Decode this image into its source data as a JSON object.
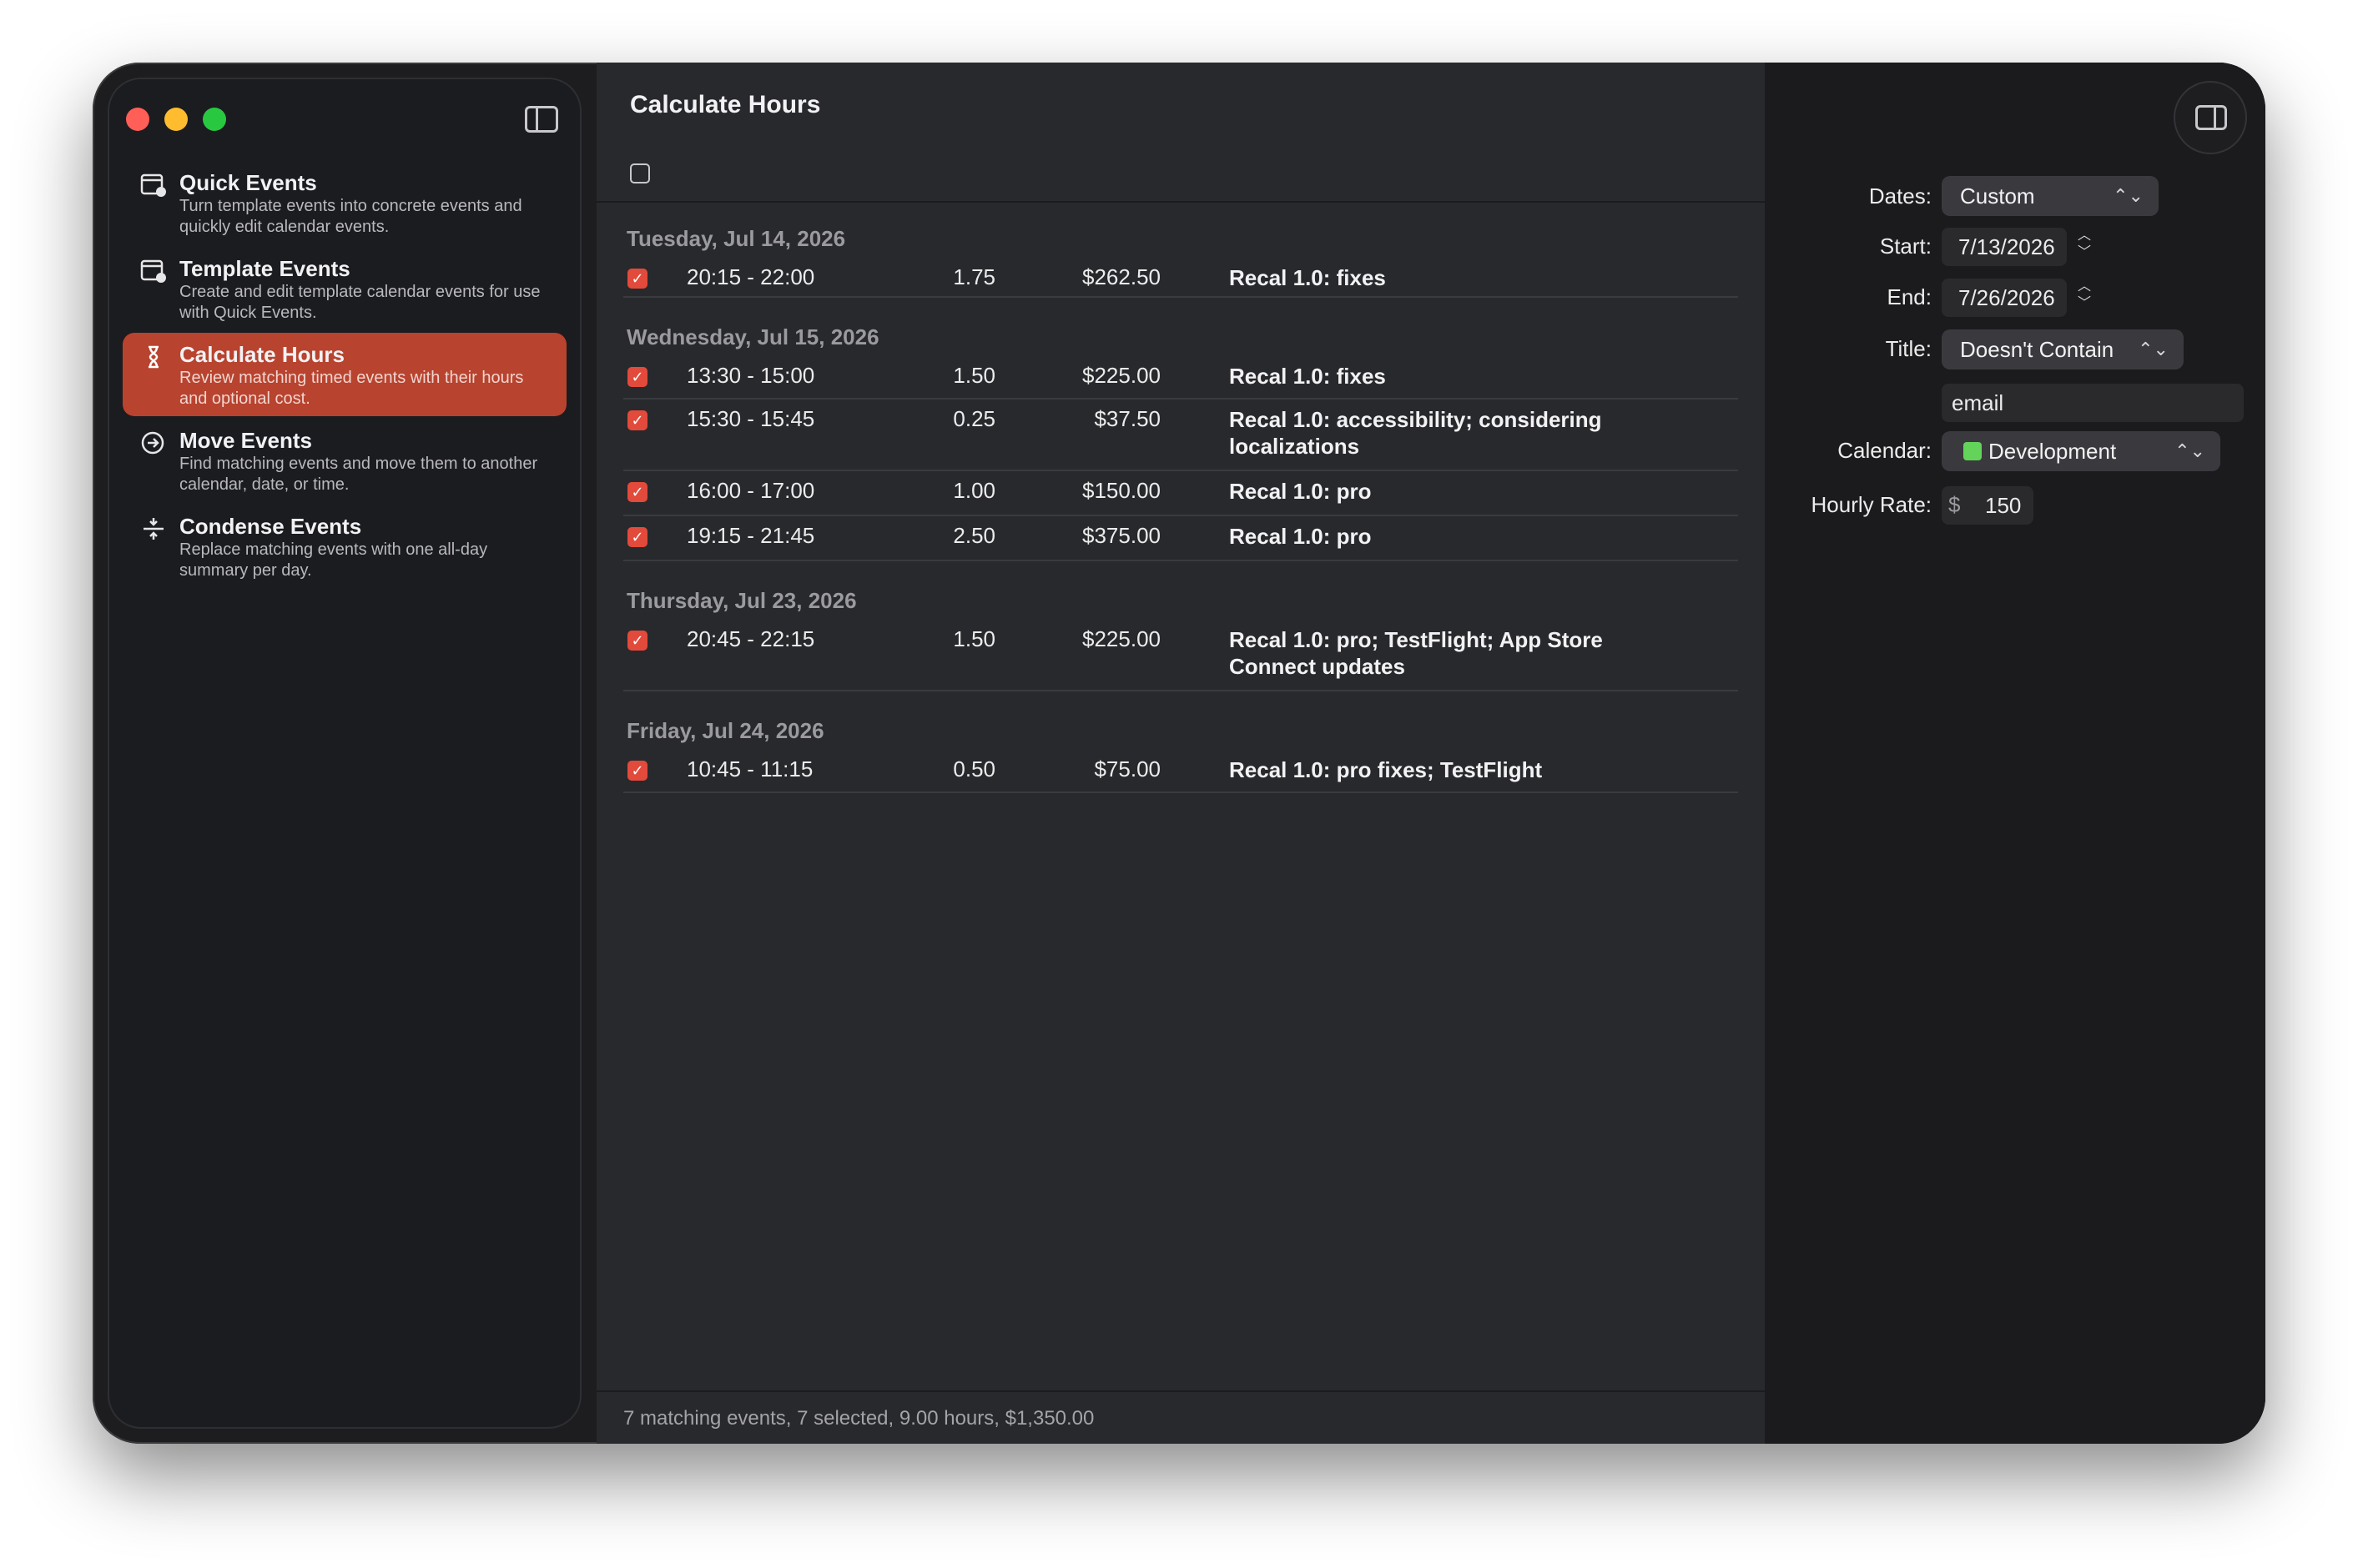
{
  "sidebar": {
    "items": [
      {
        "icon": "calendar-badge-icon",
        "title": "Quick Events",
        "desc": "Turn template events into concrete events and quickly edit calendar events.",
        "active": false
      },
      {
        "icon": "calendar-badge-icon",
        "title": "Template Events",
        "desc": "Create and edit template calendar events for use with Quick Events.",
        "active": false
      },
      {
        "icon": "hourglass-icon",
        "title": "Calculate Hours",
        "desc": "Review matching timed events with their hours and optional cost.",
        "active": true
      },
      {
        "icon": "arrow-circle-icon",
        "title": "Move Events",
        "desc": "Find matching events and move them to another calendar, date, or time.",
        "active": false
      },
      {
        "icon": "condense-icon",
        "title": "Condense Events",
        "desc": "Replace matching events with one all-day summary per day.",
        "active": false
      }
    ]
  },
  "main": {
    "title": "Calculate Hours",
    "groups": [
      {
        "date": "Tuesday, Jul 14, 2026",
        "rows": [
          {
            "time": "20:15 - 22:00",
            "hours": "1.75",
            "cost": "$262.50",
            "title": "Recal 1.0: fixes"
          }
        ]
      },
      {
        "date": "Wednesday, Jul 15, 2026",
        "rows": [
          {
            "time": "13:30 - 15:00",
            "hours": "1.50",
            "cost": "$225.00",
            "title": "Recal 1.0: fixes"
          },
          {
            "time": "15:30 - 15:45",
            "hours": "0.25",
            "cost": "$37.50",
            "title": "Recal 1.0: accessibility; considering localizations"
          },
          {
            "time": "16:00 - 17:00",
            "hours": "1.00",
            "cost": "$150.00",
            "title": "Recal 1.0: pro"
          },
          {
            "time": "19:15 - 21:45",
            "hours": "2.50",
            "cost": "$375.00",
            "title": "Recal 1.0: pro"
          }
        ]
      },
      {
        "date": "Thursday, Jul 23, 2026",
        "rows": [
          {
            "time": "20:45 - 22:15",
            "hours": "1.50",
            "cost": "$225.00",
            "title": "Recal 1.0: pro; TestFlight; App Store Connect updates"
          }
        ]
      },
      {
        "date": "Friday, Jul 24, 2026",
        "rows": [
          {
            "time": "10:45 - 11:15",
            "hours": "0.50",
            "cost": "$75.00",
            "title": "Recal 1.0: pro fixes; TestFlight"
          }
        ]
      }
    ],
    "status": "7 matching events, 7 selected, 9.00 hours, $1,350.00"
  },
  "inspector": {
    "dates_label": "Dates:",
    "dates_value": "Custom",
    "start_label": "Start:",
    "start_value": "7/13/2026",
    "end_label": "End:",
    "end_value": "7/26/2026",
    "title_label": "Title:",
    "title_mode": "Doesn't Contain",
    "title_text": "email",
    "calendar_label": "Calendar:",
    "calendar_value": "Development",
    "calendar_color": "#63d35a",
    "rate_label": "Hourly Rate:",
    "rate_currency": "$",
    "rate_value": "150"
  },
  "colors": {
    "accent": "#b8432f",
    "checkbox": "#e24a3b"
  }
}
